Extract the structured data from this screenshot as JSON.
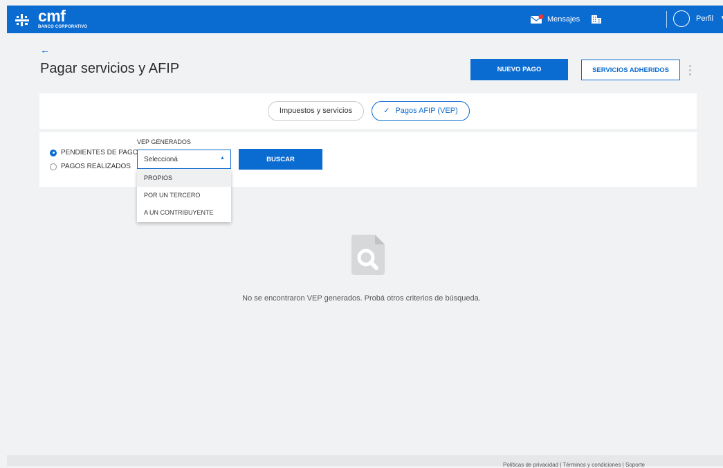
{
  "header": {
    "brand": "cmf",
    "brand_sub": "BANCO CORPORATIVO",
    "messages_label": "Mensajes",
    "profile_label": "Perfil",
    "accent_color": "#0a6bd1"
  },
  "page": {
    "title": "Pagar servicios y AFIP",
    "new_payment": "NUEVO PAGO",
    "subscribed": "SERVICIOS ADHERIDOS"
  },
  "tabs": [
    {
      "label": "Impuestos y servicios",
      "selected": false
    },
    {
      "label": "Pagos AFIP (VEP)",
      "selected": true
    }
  ],
  "filters": {
    "radios": [
      {
        "label": "PENDIENTES DE PAGO",
        "checked": true
      },
      {
        "label": "PAGOS REALIZADOS",
        "checked": false
      }
    ],
    "vep_label": "VEP GENERADOS",
    "select_value": "Seleccioná",
    "search_button": "BUSCAR",
    "options": [
      "PROPIOS",
      "POR UN TERCERO",
      "A UN CONTRIBUYENTE"
    ]
  },
  "empty_state": {
    "icon": "document-search-icon",
    "message": "No se encontraron VEP generados. Probá otros criterios de búsqueda."
  },
  "footer": {
    "links": "Políticas de privacidad | Términos y condiciones | Soporte"
  }
}
